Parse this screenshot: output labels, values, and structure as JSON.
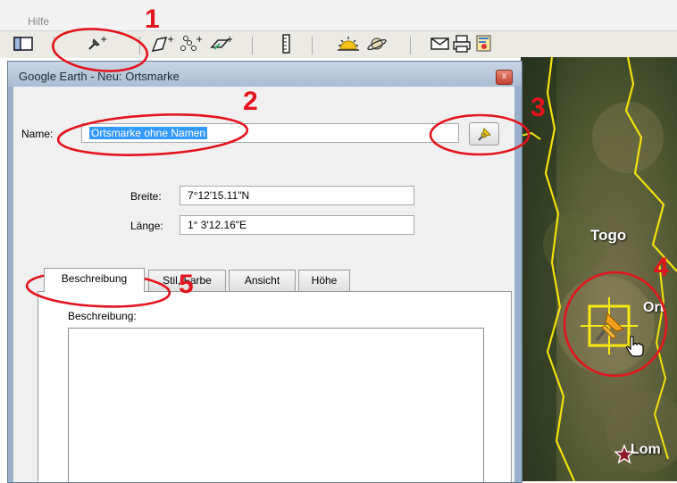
{
  "menubar": {
    "items": [
      "Hilfe"
    ]
  },
  "toolbar": {
    "buttons": [
      "sidebar-toggle-icon",
      "add-placemark-icon",
      "add-polygon-icon",
      "add-path-icon",
      "add-image-overlay-icon",
      "ruler-icon",
      "sun-icon",
      "planets-icon",
      "email-icon",
      "print-icon",
      "view-in-maps-icon"
    ]
  },
  "dialog": {
    "title": "Google Earth - Neu: Ortsmarke",
    "close_label": "x",
    "name_label": "Name:",
    "name_value": "Ortsmarke ohne Namen",
    "pin_icon": "yellow-pushpin-icon",
    "lat_label": "Breite:",
    "lat_value": "7°12'15.11\"N",
    "lon_label": "Länge:",
    "lon_value": "1° 3'12.16\"E",
    "tabs": [
      "Beschreibung",
      "Stil, Farbe",
      "Ansicht",
      "Höhe"
    ],
    "active_tab": "Beschreibung",
    "description_label": "Beschreibung:"
  },
  "map": {
    "labels": {
      "country": "Togo",
      "placemark": "Ort",
      "city": "Lom"
    },
    "placemark_icon": "yellow-pushpin-icon"
  },
  "annotations": [
    "1",
    "2",
    "3",
    "4",
    "5"
  ],
  "colors": {
    "annotation_red": "#e4141e",
    "selection_blue": "#3399ff",
    "border_yellow": "#f2e20a"
  }
}
